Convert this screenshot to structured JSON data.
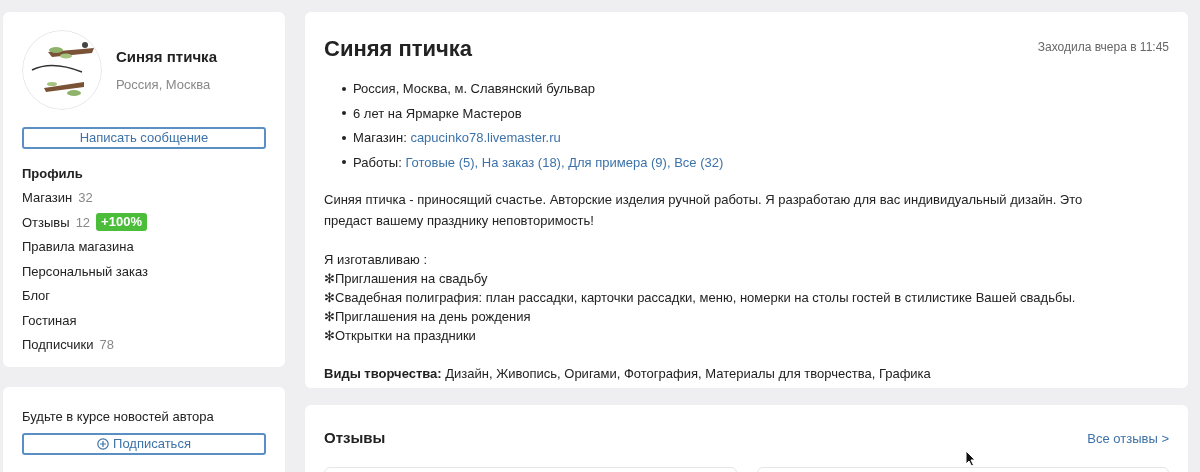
{
  "profile": {
    "name": "Синяя птичка",
    "location": "Россия, Москва",
    "message_button": "Написать сообщение"
  },
  "menu": [
    {
      "label": "Профиль",
      "selected": true
    },
    {
      "label": "Магазин",
      "count": "32",
      "selected": false
    },
    {
      "label": "Отзывы",
      "count": "12",
      "badge": "+100%",
      "selected": false
    },
    {
      "label": "Правила магазина",
      "selected": false
    },
    {
      "label": "Персональный заказ",
      "selected": false
    },
    {
      "label": "Блог",
      "selected": false
    },
    {
      "label": "Гостиная",
      "selected": false
    },
    {
      "label": "Подписчики",
      "count": "78",
      "selected": false
    }
  ],
  "subscribe": {
    "text": "Будьте в курсе новостей автора",
    "button": "Подписаться"
  },
  "main": {
    "title": "Синяя птичка",
    "last_seen": "Заходила вчера в 11:45",
    "facts": [
      {
        "kind": "text",
        "text": "Россия, Москва, м. Славянский бульвар"
      },
      {
        "kind": "text",
        "text": "6 лет на Ярмарке Мастеров"
      },
      {
        "kind": "links",
        "label": "Магазин:",
        "links": [
          "capucinko78.livemaster.ru"
        ]
      },
      {
        "kind": "links",
        "label": "Работы:",
        "links": [
          "Готовые (5),",
          "На заказ (18),",
          "Для примера (9),",
          "Все (32)"
        ]
      }
    ],
    "about": "Синяя птичка - приносящий счастье. Авторские изделия ручной работы. Я разработаю для вас индивидуальный дизайн. Это предаст вашему празднику неповторимость!",
    "making_title": "Я изготавливаю :",
    "making_items": [
      "✻Приглашения на свадьбу",
      "✻Свадебная полиграфия: план рассадки, карточки рассадки, меню, номерки на столы гостей в стилистике Вашей свадьбы.",
      "✻Приглашения на день рождения",
      "✻Открытки на праздники"
    ],
    "genres": "**Виды творчества:** Дизайн, Живопись, Оригами, Фотография, Материалы для творчества, Графика"
  },
  "reviews": {
    "title": "Отзывы",
    "all_link": "Все отзывы >"
  }
}
